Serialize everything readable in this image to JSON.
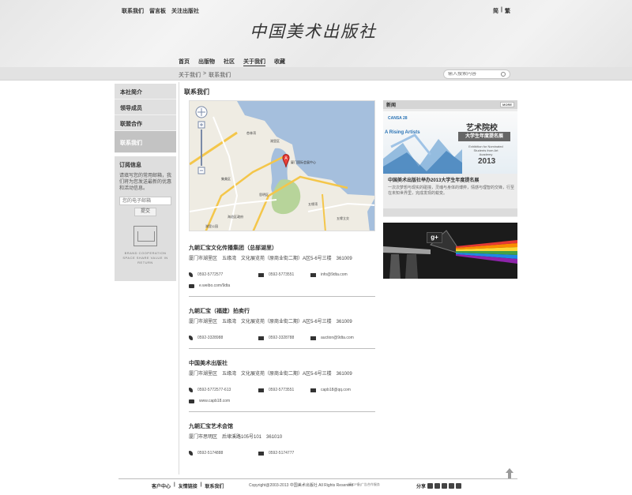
{
  "header": {
    "top_links": [
      "联系我们",
      "留言板",
      "关注出版社"
    ],
    "lang_links": [
      "简",
      "|",
      "繁"
    ],
    "logo_text": "中国美术出版社",
    "nav": [
      "首页",
      "出版物",
      "社区",
      "关于我们",
      "收藏"
    ],
    "nav_active_index": 3
  },
  "subbar": {
    "breadcrumb": [
      "关于我们",
      ">",
      "联系我们"
    ],
    "search_placeholder": "输入搜索内容"
  },
  "sidebar": {
    "items": [
      {
        "label": "本社简介"
      },
      {
        "label": "领导成员"
      },
      {
        "label": "联盟合作"
      },
      {
        "label": "联系我们"
      }
    ],
    "active_index": 3,
    "subscribe": {
      "title": "订阅信息",
      "desc": "请填写您的常用邮箱，我们将为您发送最新的优惠和活动信息。",
      "input_placeholder": "您的电子邮箱",
      "button": "提交",
      "coop_text": "BRAND COOPERATION  SPACE SHARE  VALUE IN RETURN"
    }
  },
  "main": {
    "title": "联系我们",
    "map": {
      "marker": "A",
      "labels": [
        "厦门国际会展中心",
        "湖里区",
        "五缘湾",
        "杏林湾",
        "集美区",
        "思明区",
        "五缘立交",
        "海沧区政府",
        "湖里公园"
      ]
    },
    "contacts": [
      {
        "name": "九朝汇宝文化传播集团（总部湖里）",
        "address": "厦门市湖里区　五缘湾　文化展览苑（原商业街二期）A区5-6号三楼　361009",
        "phone": "0592-5772577",
        "fax": "0592-5773551",
        "email": "info@9dta.com",
        "web": "e.weibo.com/9dta"
      },
      {
        "name": "九朝汇宝（福建）拍卖行",
        "address": "厦门市湖里区　五缘湾　文化展览苑（原商业街二期）A区5-6号三楼　361009",
        "phone": "0592-3328988",
        "fax": "0592-3328788",
        "email": "auction@9dta.com",
        "web": ""
      },
      {
        "name": "中国美术出版社",
        "address": "厦门市湖里区　五缘湾　文化展览苑（原商业街二期）A区5-6号三楼　361009",
        "phone": "0592-5772577-613",
        "fax": "0592-5773551",
        "email": "capb18@qq.com",
        "web": "www.capb18.com"
      },
      {
        "name": "九朝汇宝艺术会馆",
        "address": "厦门市思明区　后埭溪路105号101　361010",
        "phone": "0592-5174888",
        "fax": "0592-5174777",
        "email": "",
        "web": ""
      }
    ]
  },
  "news": {
    "header": "新闻",
    "more": "MORE",
    "banner_brand": "CANSA 28",
    "banner_rising": "A Rising Artists",
    "banner_title": "艺术院校",
    "banner_sub": "大学生年度提名展",
    "banner_note": "Exhibition for Nominated Students from Art Academy",
    "banner_year": "2013",
    "title": "中国美术出版社举办2013大学生年度提名展",
    "desc": "一次次梦想与现实的碰撞，灵魂与身体的博弈，情感与理智的交锋，行至在未知世界里，完成发现的蜕变。"
  },
  "footer": {
    "links": [
      "客户中心",
      "|",
      "友情链接",
      "|",
      "联系我们"
    ],
    "copyright": "Copyright@2003-2013 中国美术出版社 All Rights Reserved",
    "icp": "[闽ICP备]广告合作服务",
    "share_label": "分享"
  }
}
